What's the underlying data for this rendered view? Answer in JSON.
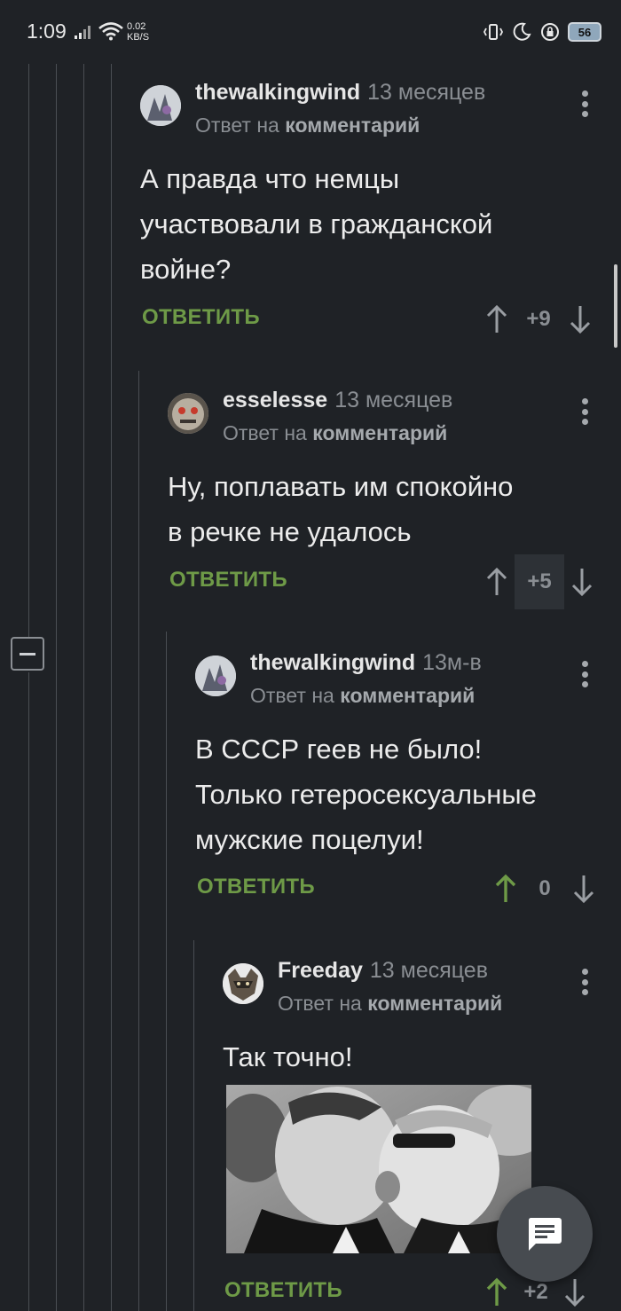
{
  "status_bar": {
    "time": "1:09",
    "net_speed_value": "0.02",
    "net_speed_unit": "KB/S",
    "battery": "56",
    "icons": [
      "signal-icon",
      "wifi-icon",
      "vibrate-icon",
      "moon-icon",
      "lock-rotation-icon",
      "battery-icon"
    ]
  },
  "comments": [
    {
      "author": "thewalkingwind",
      "time": "13 месяцев",
      "reply_prefix": "Ответ на",
      "reply_target": "комментарий",
      "body_lines": [
        "А правда что немцы",
        "участвовали в гражданской",
        "войне?"
      ],
      "reply_label": "ОТВЕТИТЬ",
      "score": "+9"
    },
    {
      "author": "esselesse",
      "time": "13 месяцев",
      "reply_prefix": "Ответ на",
      "reply_target": "комментарий",
      "body_lines": [
        "Ну, поплавать им спокойно",
        "в речке не удалось"
      ],
      "reply_label": "ОТВЕТИТЬ",
      "score": "+5"
    },
    {
      "author": "thewalkingwind",
      "time": "13м-в",
      "reply_prefix": "Ответ на",
      "reply_target": "комментарий",
      "body_lines": [
        "В СССР геев не было!",
        "Только гетеросексуальные",
        "мужские поцелуи!"
      ],
      "reply_label": "ОТВЕТИТЬ",
      "score": "0",
      "upvoted": true
    },
    {
      "author": "Freeday",
      "time": "13 месяцев",
      "reply_prefix": "Ответ на",
      "reply_target": "комментарий",
      "body_lines": [
        "Так точно!"
      ],
      "reply_label": "ОТВЕТИТЬ",
      "score": "+2",
      "upvoted": true,
      "image": "photo"
    }
  ],
  "colors": {
    "background": "#1f2226",
    "reply_green": "#6e9a47",
    "muted": "#8a8e93",
    "text": "#ececec"
  },
  "fab_icon": "comment-icon"
}
